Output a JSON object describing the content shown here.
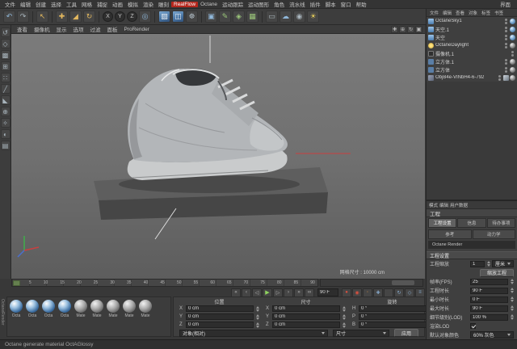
{
  "colors": {
    "accent_red": "#b5271d",
    "play_green": "#8fd45e",
    "record_red": "#d8503f",
    "viewport_gray": "#707070",
    "panel_bg": "#3f3f3f",
    "object_gray": "#b3b6b9"
  },
  "menubar": {
    "items": [
      "文件",
      "编辑",
      "创建",
      "选择",
      "工具",
      "网格",
      "捕捉",
      "动画",
      "模拟",
      "渲染",
      "雕刻",
      "RealFlow",
      "Octane",
      "运动跟踪",
      "运动图形",
      "角色",
      "流水线",
      "插件",
      "脚本",
      "窗口",
      "帮助"
    ],
    "right_label": "界面"
  },
  "toolbar": {
    "icons": [
      {
        "name": "undo-icon",
        "glyph": "↶"
      },
      {
        "name": "redo-icon",
        "glyph": "↷"
      },
      {
        "name": "live-selection-icon",
        "glyph": "↖"
      },
      {
        "name": "move-tool-icon",
        "glyph": "✚"
      },
      {
        "name": "scale-tool-icon",
        "glyph": "◢"
      },
      {
        "name": "rotate-tool-icon",
        "glyph": "↻"
      },
      {
        "name": "coordinate-system-icon",
        "glyph": "◎"
      },
      {
        "name": "render-view-icon",
        "glyph": "▨"
      },
      {
        "name": "render-region-icon",
        "glyph": "◫"
      },
      {
        "name": "render-settings-icon",
        "glyph": "☸"
      },
      {
        "name": "primitive-cube-icon",
        "glyph": "▣"
      },
      {
        "name": "spline-pen-icon",
        "glyph": "✎"
      },
      {
        "name": "subdivision-surface-icon",
        "glyph": "◈"
      },
      {
        "name": "cloner-icon",
        "glyph": "▦"
      },
      {
        "name": "floor-icon",
        "glyph": "▭"
      },
      {
        "name": "sky-icon",
        "glyph": "☁"
      },
      {
        "name": "camera-icon",
        "glyph": "◉"
      },
      {
        "name": "light-icon",
        "glyph": "☀"
      }
    ],
    "axis": [
      "X",
      "Y",
      "Z"
    ],
    "layout_icons": [
      {
        "name": "layout-panel-icon",
        "glyph": "⊞"
      },
      {
        "name": "layout-list-icon",
        "glyph": "▤"
      }
    ]
  },
  "left_toolbar": {
    "icons": [
      {
        "name": "make-editable-icon",
        "glyph": "↺"
      },
      {
        "name": "model-mode-icon",
        "glyph": "◇"
      },
      {
        "name": "texture-mode-icon",
        "glyph": "▩"
      },
      {
        "name": "workplane-icon",
        "glyph": "⊞"
      },
      {
        "name": "points-mode-icon",
        "glyph": "∷"
      },
      {
        "name": "edges-mode-icon",
        "glyph": "╱"
      },
      {
        "name": "polygons-mode-icon",
        "glyph": "◣"
      },
      {
        "name": "enable-axis-icon",
        "glyph": "⊕"
      },
      {
        "name": "snap-icon",
        "glyph": "✧"
      },
      {
        "name": "viewport-solo-icon",
        "glyph": "◐"
      },
      {
        "name": "filter-icon",
        "glyph": "▤"
      }
    ]
  },
  "viewport": {
    "menu": [
      "查看",
      "摄像机",
      "显示",
      "选项",
      "过滤",
      "面板",
      "ProRender"
    ],
    "nav_icons": [
      {
        "name": "pan-view-icon",
        "glyph": "✚"
      },
      {
        "name": "zoom-view-icon",
        "glyph": "⊕"
      },
      {
        "name": "rotate-view-icon",
        "glyph": "↻"
      },
      {
        "name": "toggle-view-icon",
        "glyph": "▣"
      }
    ],
    "grid_label": "网格尺寸 : 10000 cm"
  },
  "object_manager": {
    "menu": [
      "文件",
      "编辑",
      "查看",
      "对象",
      "标签",
      "书签"
    ],
    "rows": [
      {
        "name": "OctaneSky1"
      },
      {
        "name": "天空.1"
      },
      {
        "name": "天空"
      },
      {
        "name": "OctaneDaylight"
      },
      {
        "name": "摄像机.1"
      },
      {
        "name": "立方体.1"
      },
      {
        "name": "立方体"
      },
      {
        "name": "ObjB4e-VINbH4-6-792"
      }
    ]
  },
  "attributes": {
    "tabs": [
      "模式",
      "编辑",
      "用户数据"
    ],
    "title": "工程",
    "tab_rows": [
      [
        "工程设置",
        "信息",
        "待办事项"
      ],
      [
        "参考",
        "动力学"
      ],
      [
        "Octane Render"
      ]
    ],
    "section": "工程设置",
    "scale_label": "工程缩放",
    "scale_value": "1",
    "scale_unit": "厘米",
    "scale_button": "缩放工程",
    "rows": [
      {
        "label": "帧率(FPS)",
        "value": "25"
      },
      {
        "label": "工程时长",
        "value": "90 F"
      },
      {
        "label": "最小时长",
        "value": "0 F"
      },
      {
        "label": "最大时长",
        "value": "90 F"
      },
      {
        "label": "细节级别(LOD)",
        "value": "100 %"
      }
    ],
    "render_lod_label": "渲染LOD",
    "color_label": "默认对象颜色",
    "color_value": "60% 灰色"
  },
  "timeline": {
    "labels": [
      "0",
      "5",
      "10",
      "15",
      "20",
      "25",
      "30",
      "35",
      "40",
      "45",
      "50",
      "55",
      "60",
      "65",
      "70",
      "75",
      "80",
      "85",
      "90"
    ]
  },
  "transport": {
    "buttons": [
      {
        "name": "goto-start-button",
        "glyph": "«"
      },
      {
        "name": "prev-key-button",
        "glyph": "‹"
      },
      {
        "name": "prev-frame-button",
        "glyph": "◁"
      },
      {
        "name": "play-button",
        "glyph": "▶"
      },
      {
        "name": "next-frame-button",
        "glyph": "▷"
      },
      {
        "name": "next-key-button",
        "glyph": "›"
      },
      {
        "name": "goto-end-button",
        "glyph": "»"
      },
      {
        "name": "loop-button",
        "glyph": "∞"
      }
    ],
    "frame_value": "90 F",
    "record_buttons": [
      {
        "name": "record-keyframe-button",
        "glyph": "●"
      },
      {
        "name": "autokey-button",
        "glyph": "◉"
      },
      {
        "name": "keyframe-selection-button",
        "glyph": "◦"
      },
      {
        "name": "record-position-toggle",
        "glyph": "✚"
      },
      {
        "name": "record-scale-toggle",
        "glyph": "◢"
      },
      {
        "name": "record-rotation-toggle",
        "glyph": "↻"
      },
      {
        "name": "record-parameter-toggle",
        "glyph": "◇"
      },
      {
        "name": "record-pla-toggle",
        "glyph": "≡"
      }
    ]
  },
  "coordinates": {
    "columns": [
      {
        "header": "位置",
        "rows": [
          {
            "axis": "X",
            "value": "0 cm"
          },
          {
            "axis": "Y",
            "value": "0 cm"
          },
          {
            "axis": "Z",
            "value": "0 cm"
          }
        ]
      },
      {
        "header": "尺寸",
        "rows": [
          {
            "axis": "X",
            "value": "0 cm"
          },
          {
            "axis": "Y",
            "value": "0 cm"
          },
          {
            "axis": "Z",
            "value": "0 cm"
          }
        ]
      },
      {
        "header": "旋转",
        "rows": [
          {
            "axis": "H",
            "value": "0 °"
          },
          {
            "axis": "P",
            "value": "0 °"
          },
          {
            "axis": "B",
            "value": "0 °"
          }
        ]
      }
    ],
    "mode_value": "对象(相对)",
    "size_mode_value": "尺寸",
    "apply_label": "应用"
  },
  "materials": {
    "items": [
      {
        "label": "Octa"
      },
      {
        "label": "Octa"
      },
      {
        "label": "Octa"
      },
      {
        "label": "Octa"
      },
      {
        "label": "Mate"
      },
      {
        "label": "Mate"
      },
      {
        "label": "Mate"
      },
      {
        "label": "Mate"
      },
      {
        "label": "Mate"
      }
    ]
  },
  "statusbar": {
    "text": "Octane generate material OctAGlossy"
  },
  "side_label": "OctaneRender"
}
